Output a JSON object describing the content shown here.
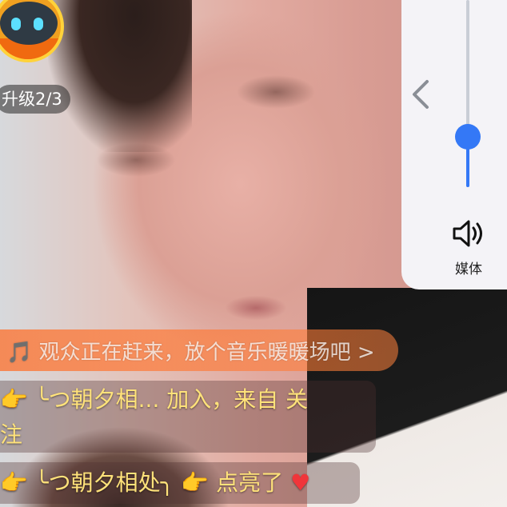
{
  "streamer": {
    "level_text": "升级2/3"
  },
  "volume_panel": {
    "label": "媒体",
    "level_percent": 27,
    "accent_color": "#3478f6",
    "icons": [
      "chevron-left-icon",
      "speaker-icon"
    ]
  },
  "chat": {
    "banner_text": "🎵 观众正在赶来，放个音乐暖暖场吧 >",
    "messages": [
      {
        "emoji": "👉",
        "name": "╰つ朝夕相...",
        "text": " 加入，来自 关",
        "text_line2": "注"
      },
      {
        "emoji": "👉",
        "name": "╰つ朝夕相处╮",
        "emoji2": "👉",
        "text": " 点亮了 ",
        "icon": "♥"
      }
    ]
  }
}
